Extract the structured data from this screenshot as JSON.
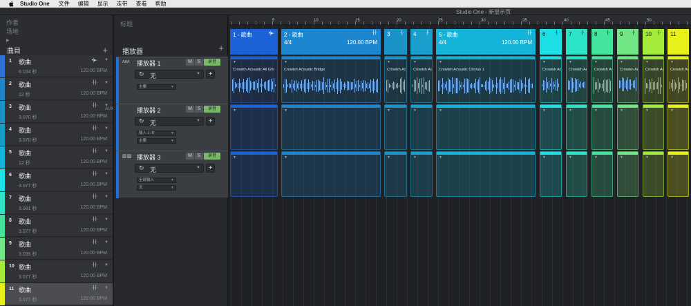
{
  "menubar": {
    "app": "Studio One",
    "items": [
      "文件",
      "编辑",
      "显示",
      "走带",
      "查看",
      "帮助"
    ]
  },
  "window_title": "Studio One - 新显示页",
  "left": {
    "author_label": "作者",
    "venue_label": "场地",
    "list_title": "曲目",
    "songs": [
      {
        "num": "1",
        "name": "歌曲",
        "time": "6.154 秒",
        "bpm": "120.00 BPM",
        "color": "#2e6fd8",
        "marker": "•|▸·"
      },
      {
        "num": "2",
        "name": "歌曲",
        "time": "12 秒",
        "bpm": "120.00 BPM",
        "color": "#1f84c8",
        "marker": "·|·|·"
      },
      {
        "num": "3",
        "name": "歌曲",
        "time": "3.070 秒",
        "bpm": "120.00 BPM",
        "color": "#1b93c4",
        "marker": "·|·|·"
      },
      {
        "num": "4",
        "name": "歌曲",
        "time": "3.070 秒",
        "bpm": "120.00 BPM",
        "color": "#179ec8",
        "marker": "·|·|·"
      },
      {
        "num": "5",
        "name": "歌曲",
        "time": "12 秒",
        "bpm": "120.00 BPM",
        "color": "#13b4d8",
        "marker": "·|·|·"
      },
      {
        "num": "6",
        "name": "歌曲",
        "time": "3.077 秒",
        "bpm": "120.00 BPM",
        "color": "#1de3e6",
        "marker": "·|·|·"
      },
      {
        "num": "7",
        "name": "歌曲",
        "time": "3.081 秒",
        "bpm": "120.00 BPM",
        "color": "#2fe3c4",
        "marker": "·|·|·"
      },
      {
        "num": "8",
        "name": "歌曲",
        "time": "3.077 秒",
        "bpm": "120.00 BPM",
        "color": "#46e39a",
        "marker": "·|·|·"
      },
      {
        "num": "9",
        "name": "歌曲",
        "time": "3.035 秒",
        "bpm": "120.00 BPM",
        "color": "#6ee784",
        "marker": "·|·|·"
      },
      {
        "num": "10",
        "name": "歌曲",
        "time": "3.077 秒",
        "bpm": "120.00 BPM",
        "color": "#a6ea3a",
        "marker": "·|·|·"
      },
      {
        "num": "11",
        "name": "歌曲",
        "time": "3.077 秒",
        "bpm": "120.00 BPM",
        "color": "#e8f019",
        "marker": "·|·|·"
      }
    ]
  },
  "mid": {
    "title_label": "标题",
    "players_label": "播放器",
    "tracks": [
      {
        "name": "播放器 1",
        "type_icon": "ʌʌʌ",
        "aux": "",
        "mute": "M",
        "solo": "S",
        "rec": "录音",
        "value": "无",
        "opt1": "主要",
        "opt2": "",
        "color": "#1f6fd8"
      },
      {
        "name": "播放器 2",
        "type_icon": "",
        "aux": "AUX",
        "mute": "M",
        "solo": "S",
        "rec": "录音",
        "value": "无",
        "opt1": "输入 L+R",
        "opt2": "主要",
        "color": "#1f6fd8"
      },
      {
        "name": "播放器 3",
        "type_icon": "▥▥",
        "aux": "",
        "mute": "M",
        "solo": "S",
        "rec": "录音",
        "value": "无",
        "opt1": "全部输入",
        "opt2": "无",
        "color": "#1f6fd8"
      }
    ]
  },
  "ruler": {
    "ticks": [
      "5",
      "10",
      "15",
      "20",
      "25",
      "30",
      "35",
      "40",
      "45",
      "50"
    ]
  },
  "segments": [
    {
      "label": "1 - 歌曲",
      "marker": "•|▸·",
      "sig": "",
      "bpm": "",
      "color": "#1a62d6"
    },
    {
      "label": "2 - 歌曲",
      "marker": "·|·|·",
      "sig": "4/4",
      "bpm": "120.00 BPM",
      "color": "#1c86d0"
    },
    {
      "label": "3",
      "marker": "·|·",
      "sig": "",
      "bpm": "",
      "color": "#1b93c8"
    },
    {
      "label": "4",
      "marker": "·|·",
      "sig": "",
      "bpm": "",
      "color": "#189fcd"
    },
    {
      "label": "5 - 歌曲",
      "marker": "·|·|·",
      "sig": "4/4",
      "bpm": "120.00 BPM",
      "color": "#13b4d8"
    },
    {
      "label": "6",
      "marker": "·|·",
      "sig": "",
      "bpm": "",
      "color": "#1ce0e6"
    },
    {
      "label": "7",
      "marker": "·|·",
      "sig": "",
      "bpm": "",
      "color": "#2be3c6"
    },
    {
      "label": "8",
      "marker": "·|·",
      "sig": "",
      "bpm": "",
      "color": "#44e39e"
    },
    {
      "label": "9",
      "marker": "·|·",
      "sig": "",
      "bpm": "",
      "color": "#70e784"
    },
    {
      "label": "10",
      "marker": "·|·",
      "sig": "",
      "bpm": "",
      "color": "#a3ea3a"
    },
    {
      "label": "11",
      "marker": "·",
      "sig": "",
      "bpm": "",
      "color": "#e8f019"
    }
  ],
  "clips": [
    "Crowish Acoustic All Gro",
    "Crowish Acoustic Bridge",
    "Crowish Ac",
    "Crowish Ac",
    "Crowish Acoustic Chorus 1",
    "Crowish Ac",
    "Crowish Ac",
    "Crowish Ac",
    "Crowish Ac",
    "Crowish Ac",
    "Crowish Ac"
  ]
}
